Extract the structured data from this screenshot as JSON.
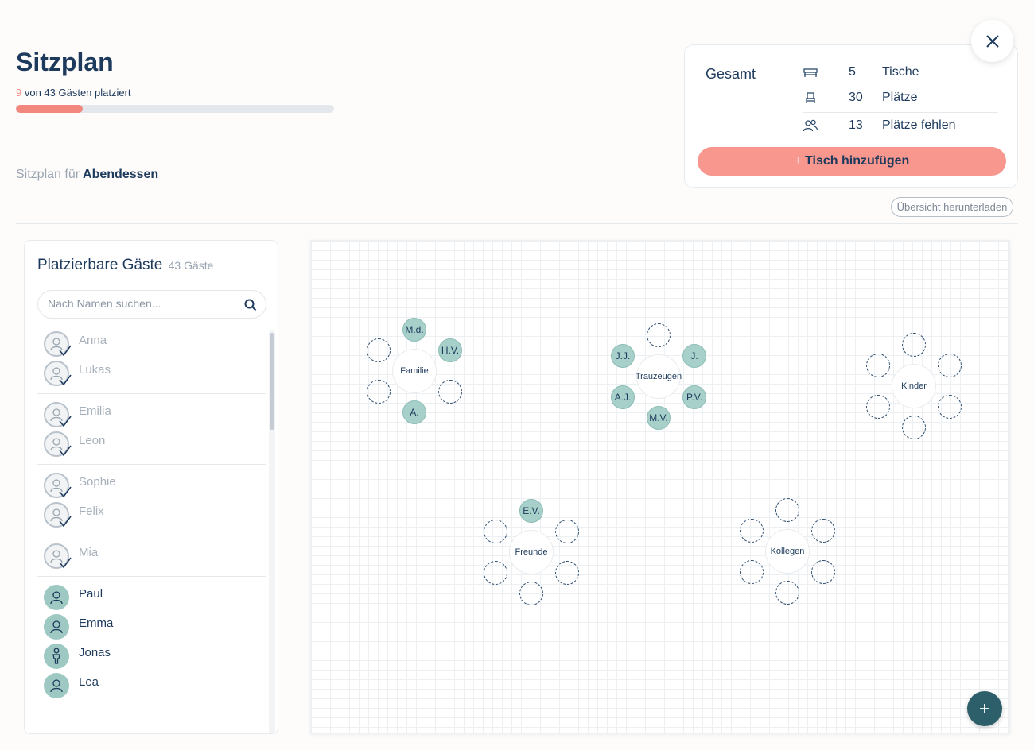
{
  "header": {
    "title": "Sitzplan",
    "placed_count": "9",
    "progress_suffix": " von 43 Gästen platziert",
    "progress_fraction": 0.21,
    "plan_for_label": "Sitzplan für",
    "event_name": "Abendessen"
  },
  "summary": {
    "title": "Gesamt",
    "tables_value": "5",
    "tables_label": "Tische",
    "seats_value": "30",
    "seats_label": "Plätze",
    "missing_value": "13",
    "missing_label": "Plätze fehlen",
    "add_table_plus": "+",
    "add_table_label": "Tisch hinzufügen"
  },
  "download_label": "Übersicht herunterladen",
  "guest_panel": {
    "title": "Platzierbare Gäste",
    "count": "43 Gäste",
    "search_placeholder": "Nach Namen suchen...",
    "groups": [
      [
        {
          "name": "Anna",
          "placed": true,
          "type": "adult"
        },
        {
          "name": "Lukas",
          "placed": true,
          "type": "adult"
        }
      ],
      [
        {
          "name": "Emilia",
          "placed": true,
          "type": "adult"
        },
        {
          "name": "Leon",
          "placed": true,
          "type": "adult"
        }
      ],
      [
        {
          "name": "Sophie",
          "placed": true,
          "type": "adult"
        },
        {
          "name": "Felix",
          "placed": true,
          "type": "adult"
        }
      ],
      [
        {
          "name": "Mia",
          "placed": true,
          "type": "adult"
        }
      ],
      [
        {
          "name": "Paul",
          "placed": false,
          "type": "adult"
        },
        {
          "name": "Emma",
          "placed": false,
          "type": "adult"
        },
        {
          "name": "Jonas",
          "placed": false,
          "type": "child"
        },
        {
          "name": "Lea",
          "placed": false,
          "type": "adult"
        }
      ]
    ]
  },
  "tables": [
    {
      "name": "Familie",
      "seats": [
        "M.d.",
        "H.V.",
        "",
        "A.",
        "",
        ""
      ]
    },
    {
      "name": "Trauzeugen",
      "seats": [
        "",
        "J.",
        "P.V.",
        "M.V.",
        "A.J.",
        "J.J."
      ]
    },
    {
      "name": "Kinder",
      "seats": [
        "",
        "",
        "",
        "",
        "",
        ""
      ]
    },
    {
      "name": "Freunde",
      "seats": [
        "E.V.",
        "",
        "",
        "",
        "",
        ""
      ]
    },
    {
      "name": "Kollegen",
      "seats": [
        "",
        "",
        "",
        "",
        "",
        ""
      ]
    }
  ],
  "colors": {
    "accent": "#f4877d",
    "seat_filled": "#a8d0ca",
    "navy": "#1d3a5c",
    "fab": "#2c5f6a"
  }
}
